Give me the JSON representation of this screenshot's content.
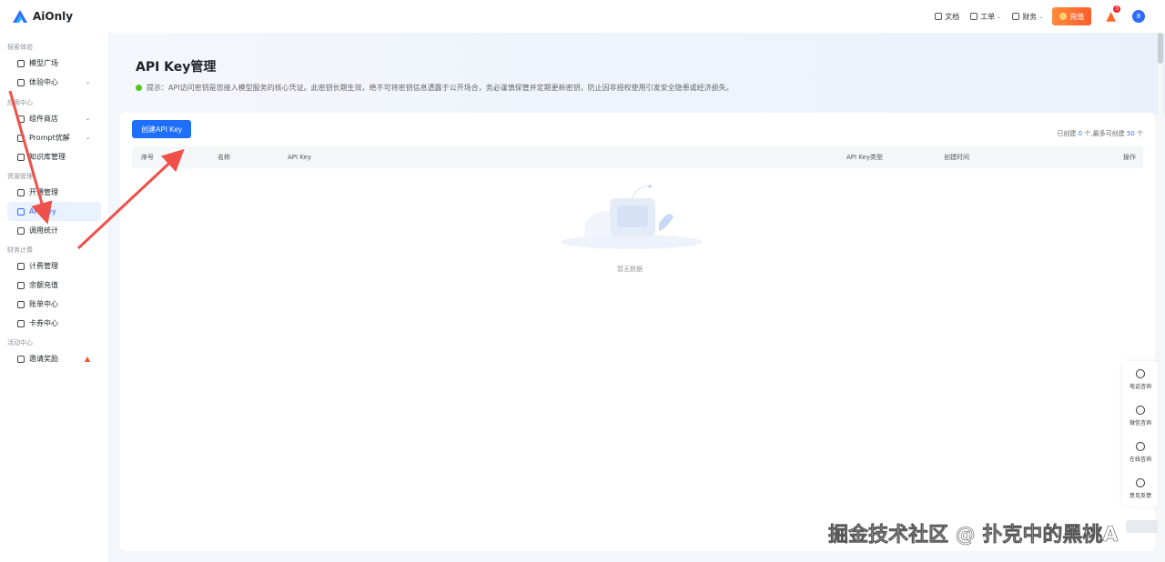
{
  "app": {
    "logo_text": "AiOnly"
  },
  "topbar": {
    "docs": "文档",
    "tickets": "工单",
    "finance": "财务",
    "recharge": "充值",
    "fire_badge": "3",
    "avatar_initial": "8"
  },
  "sidebar": {
    "sections": [
      {
        "title": "探索体验",
        "items": [
          {
            "label": "模型广场"
          },
          {
            "label": "体验中心"
          }
        ]
      },
      {
        "title": "应用中心",
        "items": [
          {
            "label": "组件商店"
          },
          {
            "label": "Prompt优解"
          },
          {
            "label": "知识库管理"
          }
        ]
      },
      {
        "title": "资源管理",
        "items": [
          {
            "label": "开通管理"
          },
          {
            "label": "API Key"
          },
          {
            "label": "调用统计"
          }
        ]
      },
      {
        "title": "财务计费",
        "items": [
          {
            "label": "计费管理"
          },
          {
            "label": "余额充值"
          },
          {
            "label": "账单中心"
          },
          {
            "label": "卡券中心"
          }
        ]
      },
      {
        "title": "活动中心",
        "items": [
          {
            "label": "邀请奖励"
          }
        ]
      }
    ]
  },
  "main": {
    "title": "API Key管理",
    "hint": "提示：API访问密钥是您接入模型服务的核心凭证。此密钥长期生效，绝不可将密钥信息透露于公开场合，务必谨慎保管并定期更新密钥，防止因非授权使用引发安全隐患或经济损失。",
    "create_button": "创建API Key",
    "quota_prefix": "已创建",
    "quota_created": "0",
    "quota_mid": "个,最多可创建",
    "quota_max": "50",
    "quota_suffix": "个",
    "columns": [
      "序号",
      "名称",
      "API Key",
      "API Key类型",
      "创建时间",
      "操作"
    ],
    "empty_text": "暂无数据"
  },
  "float_panel": {
    "items": [
      {
        "label": "电话咨询"
      },
      {
        "label": "微信咨询"
      },
      {
        "label": "在线咨询"
      },
      {
        "label": "意见反馈"
      }
    ]
  },
  "watermark": "掘金技术社区 @ 扑克中的黑桃A",
  "colors": {
    "accent": "#1f6fff",
    "annotation_arrow": "#f0504a"
  }
}
